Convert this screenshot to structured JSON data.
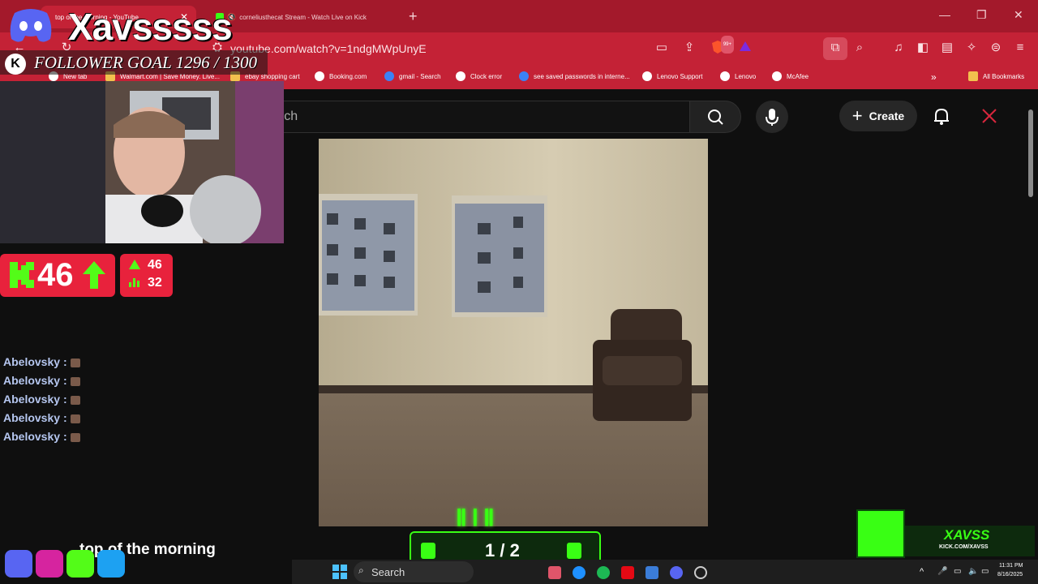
{
  "browser": {
    "tabs": [
      {
        "label": "top of the morning - YouTube",
        "active": true
      },
      {
        "label": "corneliusthecat Stream - Watch Live on Kick",
        "active": false
      }
    ],
    "url": "youtube.com/watch?v=1ndgMWpUnyE",
    "extensions_badge": "99+",
    "bookmarks": [
      {
        "label": "New tab",
        "icon": "globe-icon"
      },
      {
        "label": "Walmart.com | Save Money. Live...",
        "icon": "walmart-icon"
      },
      {
        "label": "ebay shopping cart",
        "icon": "ebay-icon"
      },
      {
        "label": "Booking.com",
        "icon": "globe-icon"
      },
      {
        "label": "gmail - Search",
        "icon": "search-icon"
      },
      {
        "label": "Clock error",
        "icon": "globe-icon"
      },
      {
        "label": "see saved passwords in interne...",
        "icon": "search-icon"
      },
      {
        "label": "Lenovo Support",
        "icon": "globe-icon"
      },
      {
        "label": "Lenovo",
        "icon": "globe-icon"
      },
      {
        "label": "McAfee",
        "icon": "globe-icon"
      }
    ],
    "all_bookmarks": "All Bookmarks"
  },
  "youtube": {
    "search_placeholder": "arch",
    "create_label": "Create"
  },
  "overlay": {
    "channel_name": "Xavsssss",
    "follower_goal": "FOLLOWER GOAL 1296 / 1300",
    "kick_count": "46",
    "stats": {
      "up": "46",
      "bars": "32"
    },
    "chat": [
      {
        "user": "Abelovsky",
        "sep": ":"
      },
      {
        "user": "Abelovsky",
        "sep": ":"
      },
      {
        "user": "Abelovsky",
        "sep": ":"
      },
      {
        "user": "Abelovsky",
        "sep": ":"
      },
      {
        "user": "Abelovsky",
        "sep": ":"
      }
    ],
    "caption": "top of the morning",
    "counter": "1 / 2",
    "kick_badge": {
      "name": "XAVSS",
      "url": "KICK.COM/XAVSS"
    },
    "accent": "#39ff14"
  },
  "taskbar": {
    "search_label": "Search",
    "time": "11:31 PM",
    "date": "8/16/2025"
  }
}
